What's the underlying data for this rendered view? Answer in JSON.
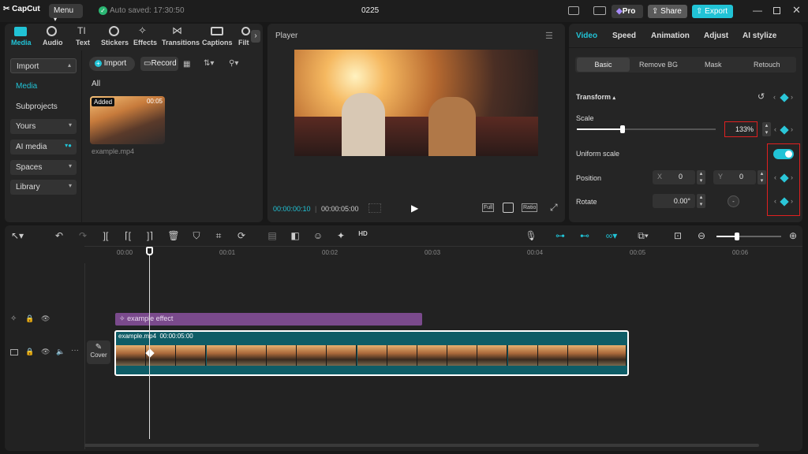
{
  "titlebar": {
    "app_name": "CapCut",
    "menu_label": "Menu",
    "autosave": "Auto saved: 17:30:50",
    "project_name": "0225",
    "pro_label": "Pro",
    "share_label": "Share",
    "export_label": "Export"
  },
  "media_tabs": [
    {
      "label": "Media"
    },
    {
      "label": "Audio"
    },
    {
      "label": "Text"
    },
    {
      "label": "Stickers"
    },
    {
      "label": "Effects"
    },
    {
      "label": "Transitions"
    },
    {
      "label": "Captions"
    },
    {
      "label": "Filt"
    }
  ],
  "sidebar": {
    "import": "Import",
    "media": "Media",
    "subprojects": "Subprojects",
    "yours": "Yours",
    "ai_media": "AI media",
    "spaces": "Spaces",
    "library": "Library"
  },
  "media_panel": {
    "import_btn": "Import",
    "record_btn": "Record",
    "filter_all": "All",
    "clip_badge": "Added",
    "clip_duration": "00:05",
    "clip_name": "example.mp4"
  },
  "player": {
    "title": "Player",
    "current_time": "00:00:00:10",
    "total_time": "00:00:05:00",
    "full_label": "Full",
    "ratio_label": "Ratio"
  },
  "inspector": {
    "tabs": [
      "Video",
      "Speed",
      "Animation",
      "Adjust",
      "AI stylize"
    ],
    "subtabs": [
      "Basic",
      "Remove BG",
      "Mask",
      "Retouch"
    ],
    "transform": "Transform",
    "scale_label": "Scale",
    "scale_value": "133%",
    "scale_fraction": 0.33,
    "uniform_scale": "Uniform scale",
    "position_label": "Position",
    "pos_x_label": "X",
    "pos_x": "0",
    "pos_y_label": "Y",
    "pos_y": "0",
    "rotate_label": "Rotate",
    "rotate_value": "0.00°"
  },
  "timeline": {
    "ruler": [
      "00:00",
      "00:01",
      "00:02",
      "00:03",
      "00:04",
      "00:05",
      "00:06"
    ],
    "effect_clip": "example effect",
    "video_clip_name": "example.mp4",
    "video_clip_duration": "00:00:05:00",
    "cover_label": "Cover"
  },
  "colors": {
    "accent": "#21c3d6",
    "pro": "#8b5cf6",
    "effect_track": "#7a4a8c",
    "video_track": "#0e5c66",
    "highlight": "#e02020"
  }
}
